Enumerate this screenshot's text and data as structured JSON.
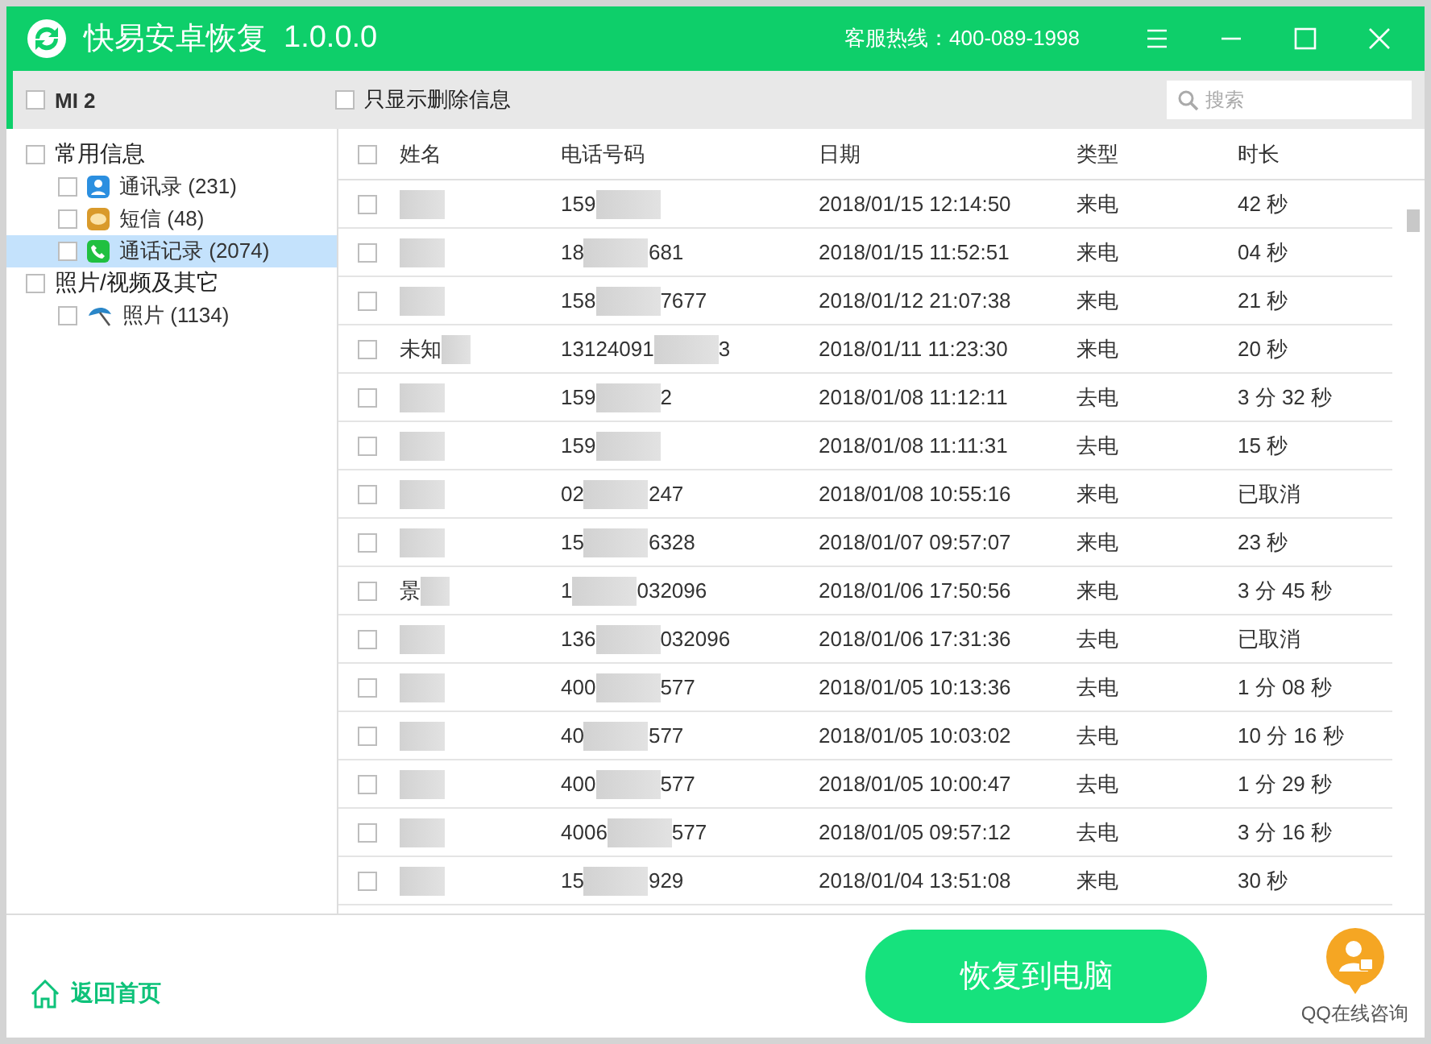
{
  "window": {
    "title": "快易安卓恢复",
    "version": "1.0.0.0",
    "hotline": "客服热线：400-089-1998"
  },
  "toolbar": {
    "device": {
      "label": "MI 2",
      "checked": false
    },
    "deleted_only": {
      "label": "只显示删除信息",
      "checked": false
    },
    "search": {
      "placeholder": "搜索"
    }
  },
  "sidebar": [
    {
      "label": "常用信息",
      "checked": false,
      "children": [
        {
          "label": "通讯录 (231)",
          "kind": "contacts",
          "checked": false,
          "selected": false
        },
        {
          "label": "短信 (48)",
          "kind": "sms",
          "checked": false,
          "selected": false
        },
        {
          "label": "通话记录 (2074)",
          "kind": "calls",
          "checked": false,
          "selected": true
        }
      ]
    },
    {
      "label": "照片/视频及其它",
      "checked": false,
      "children": [
        {
          "label": "照片 (1134)",
          "kind": "photos",
          "checked": false,
          "selected": false
        }
      ]
    }
  ],
  "table": {
    "select_all_checked": false,
    "columns": [
      "姓名",
      "电话号码",
      "日期",
      "类型",
      "时长"
    ],
    "rows": [
      {
        "checked": false,
        "name": "",
        "phone_start": "159",
        "phone_end": "",
        "date": "2018/01/15 12:14:50",
        "type": "来电",
        "duration": "42 秒"
      },
      {
        "checked": false,
        "name": "",
        "phone_start": "18",
        "phone_end": "681",
        "date": "2018/01/15 11:52:51",
        "type": "来电",
        "duration": "04 秒"
      },
      {
        "checked": false,
        "name": "",
        "phone_start": "158",
        "phone_end": "7677",
        "date": "2018/01/12 21:07:38",
        "type": "来电",
        "duration": "21 秒"
      },
      {
        "checked": false,
        "name": "未知",
        "phone_start": "13124091",
        "phone_end": "3",
        "date": "2018/01/11 11:23:30",
        "type": "来电",
        "duration": "20 秒"
      },
      {
        "checked": false,
        "name": "",
        "phone_start": "159",
        "phone_end": "2",
        "date": "2018/01/08 11:12:11",
        "type": "去电",
        "duration": "3 分 32 秒"
      },
      {
        "checked": false,
        "name": "",
        "phone_start": "159",
        "phone_end": "",
        "date": "2018/01/08 11:11:31",
        "type": "去电",
        "duration": "15 秒"
      },
      {
        "checked": false,
        "name": "",
        "phone_start": "02",
        "phone_end": "247",
        "date": "2018/01/08 10:55:16",
        "type": "来电",
        "duration": "已取消"
      },
      {
        "checked": false,
        "name": "",
        "phone_start": "15",
        "phone_end": "6328",
        "date": "2018/01/07 09:57:07",
        "type": "来电",
        "duration": "23 秒"
      },
      {
        "checked": false,
        "name": "景",
        "phone_start": "1",
        "phone_end": "032096",
        "date": "2018/01/06 17:50:56",
        "type": "来电",
        "duration": "3 分 45 秒"
      },
      {
        "checked": false,
        "name": "",
        "phone_start": "136",
        "phone_end": "032096",
        "date": "2018/01/06 17:31:36",
        "type": "去电",
        "duration": "已取消"
      },
      {
        "checked": false,
        "name": "",
        "phone_start": "400",
        "phone_end": "577",
        "date": "2018/01/05 10:13:36",
        "type": "去电",
        "duration": "1 分 08 秒"
      },
      {
        "checked": false,
        "name": "",
        "phone_start": "40",
        "phone_end": "577",
        "date": "2018/01/05 10:03:02",
        "type": "去电",
        "duration": "10 分 16 秒"
      },
      {
        "checked": false,
        "name": "",
        "phone_start": "400",
        "phone_end": "577",
        "date": "2018/01/05 10:00:47",
        "type": "去电",
        "duration": "1 分 29 秒"
      },
      {
        "checked": false,
        "name": "",
        "phone_start": "4006",
        "phone_end": "577",
        "date": "2018/01/05 09:57:12",
        "type": "去电",
        "duration": "3 分 16 秒"
      },
      {
        "checked": false,
        "name": "",
        "phone_start": "15",
        "phone_end": "929",
        "date": "2018/01/04 13:51:08",
        "type": "来电",
        "duration": "30 秒"
      }
    ]
  },
  "footer": {
    "home": "返回首页",
    "recover": "恢复到电脑",
    "support": "QQ在线咨询"
  }
}
